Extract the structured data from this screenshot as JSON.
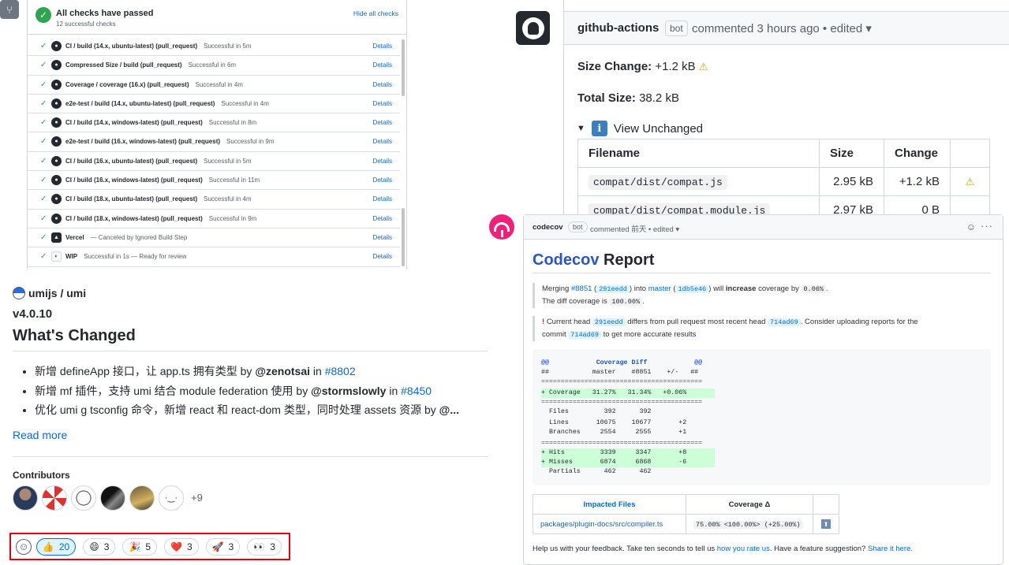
{
  "checks": {
    "merge_icon": "⑂",
    "title": "All checks have passed",
    "subtitle": "12 successful checks",
    "hide_label": "Hide all checks",
    "rows": [
      {
        "name": "CI / build (14.x, ubuntu-latest) (pull_request)",
        "status": "Successful in 5m",
        "details": "Details",
        "icon": "github-icon"
      },
      {
        "name": "Compressed Size / build (pull_request)",
        "status": "Successful in 6m",
        "details": "Details",
        "icon": "github-icon"
      },
      {
        "name": "Coverage / coverage (16.x) (pull_request)",
        "status": "Successful in 4m",
        "details": "Details",
        "icon": "github-icon"
      },
      {
        "name": "e2e-test / build (14.x, ubuntu-latest) (pull_request)",
        "status": "Successful in 4m",
        "details": "Details",
        "icon": "github-icon"
      },
      {
        "name": "CI / build (14.x, windows-latest) (pull_request)",
        "status": "Successful in 8m",
        "details": "Details",
        "icon": "github-icon"
      },
      {
        "name": "e2e-test / build (16.x, windows-latest) (pull_request)",
        "status": "Successful in 9m",
        "details": "Details",
        "icon": "github-icon"
      },
      {
        "name": "CI / build (16.x, ubuntu-latest) (pull_request)",
        "status": "Successful in 5m",
        "details": "Details",
        "icon": "github-icon"
      },
      {
        "name": "CI / build (16.x, windows-latest) (pull_request)",
        "status": "Successful in 11m",
        "details": "Details",
        "icon": "github-icon"
      },
      {
        "name": "CI / build (18.x, ubuntu-latest) (pull_request)",
        "status": "Successful in 4m",
        "details": "Details",
        "icon": "github-icon"
      },
      {
        "name": "CI / build (18.x, windows-latest) (pull_request)",
        "status": "Successful in 9m",
        "details": "Details",
        "icon": "github-icon"
      },
      {
        "name": "Vercel",
        "status": "— Canceled by Ignored Build Step",
        "details": "Details",
        "icon": "vercel-icon"
      },
      {
        "name": "WIP",
        "status": "Successful in 1s — Ready for review",
        "details": "Details",
        "icon": "wip-icon"
      }
    ]
  },
  "release": {
    "repo": "umijs / umi",
    "version": "v4.0.10",
    "heading": "What's Changed",
    "changes": [
      {
        "text": "新增 defineApp 接口，让 app.ts 拥有类型 by ",
        "author": "@zenotsai",
        "in": " in ",
        "pr": "#8802"
      },
      {
        "text": "新增 mf 插件，支持 umi 结合 module federation 使用 by ",
        "author": "@stormslowly",
        "in": " in ",
        "pr": "#8450"
      },
      {
        "text": "优化 umi g tsconfig 命令，新增 react 和 react-dom 类型，同时处理 assets 资源 by ",
        "author": "@...",
        "in": "",
        "pr": ""
      }
    ],
    "read_more": "Read more",
    "contributors_title": "Contributors",
    "contributors_more": "+9"
  },
  "reactions": [
    {
      "emoji": "👍",
      "count": "20",
      "active": true
    },
    {
      "emoji": "😄",
      "count": "3",
      "active": false
    },
    {
      "emoji": "🎉",
      "count": "5",
      "active": false
    },
    {
      "emoji": "❤️",
      "count": "3",
      "active": false
    },
    {
      "emoji": "🚀",
      "count": "3",
      "active": false
    },
    {
      "emoji": "👀",
      "count": "3",
      "active": false
    }
  ],
  "gh_comment": {
    "author": "github-actions",
    "bot": "bot",
    "meta": "commented 3 hours ago • edited ▾",
    "size_change_label": "Size Change:",
    "size_change_value": "+1.2 kB",
    "total_size_label": "Total Size:",
    "total_size_value": "38.2 kB",
    "unchanged_label": "View Unchanged",
    "table_headers": [
      "Filename",
      "Size",
      "Change"
    ],
    "rows": [
      {
        "file": "compat/dist/compat.js",
        "size": "2.95 kB",
        "change": "+1.2 kB",
        "warn": "⚠"
      },
      {
        "file": "compat/dist/compat.module.js",
        "size": "2.97 kB",
        "change": "0 B",
        "warn": ""
      }
    ]
  },
  "codecov": {
    "author": "codecov",
    "bot": "bot",
    "meta": "commented 前天 • edited ▾",
    "title_brand": "Codecov",
    "title_rest": " Report",
    "merge": {
      "merging": "Merging ",
      "pr": "#8851",
      "open": " (",
      "head": "291eedd",
      "into": ") into ",
      "branch": "master",
      "open2": " (",
      "base": "1db5e46",
      "will": ") will ",
      "increase": "increase",
      "by": " coverage by ",
      "delta": "0.06%",
      "end": ".",
      "diff_line": "The diff coverage is ",
      "diff_value": "100.00%",
      "diff_end": "."
    },
    "head_warn": {
      "lead": "Current head ",
      "head": "291eedd",
      "mid": " differs from pull request most recent head ",
      "recent": "714ad69",
      "tail": ". Consider uploading reports for the",
      "line2a": "commit ",
      "commit": "714ad69",
      "line2b": " to get more accurate results"
    },
    "diff": [
      "@@            Coverage Diff            @@",
      "##           master    #8851    +/-   ##",
      "=========================================",
      "+ Coverage   31.27%   31.34%   +0.06%",
      "=========================================",
      "  Files         392      392",
      "  Lines       10675    10677       +2",
      "  Branches     2554     2555       +1",
      "=========================================",
      "+ Hits         3339     3347       +8",
      "+ Misses       6874     6868       -6",
      "  Partials      462      462"
    ],
    "files_headers": [
      "Impacted Files",
      "Coverage Δ",
      ""
    ],
    "files": [
      {
        "file": "packages/plugin-docs/src/compiler.ts",
        "coverage": "75.00% <100.00%> (+25.00%)",
        "icon": "⬆"
      }
    ],
    "feedback": {
      "text": "Help us with your feedback. Take ten seconds to tell us ",
      "link1": "how you rate us",
      "mid": ". Have a feature suggestion? ",
      "link2": "Share it here."
    }
  }
}
